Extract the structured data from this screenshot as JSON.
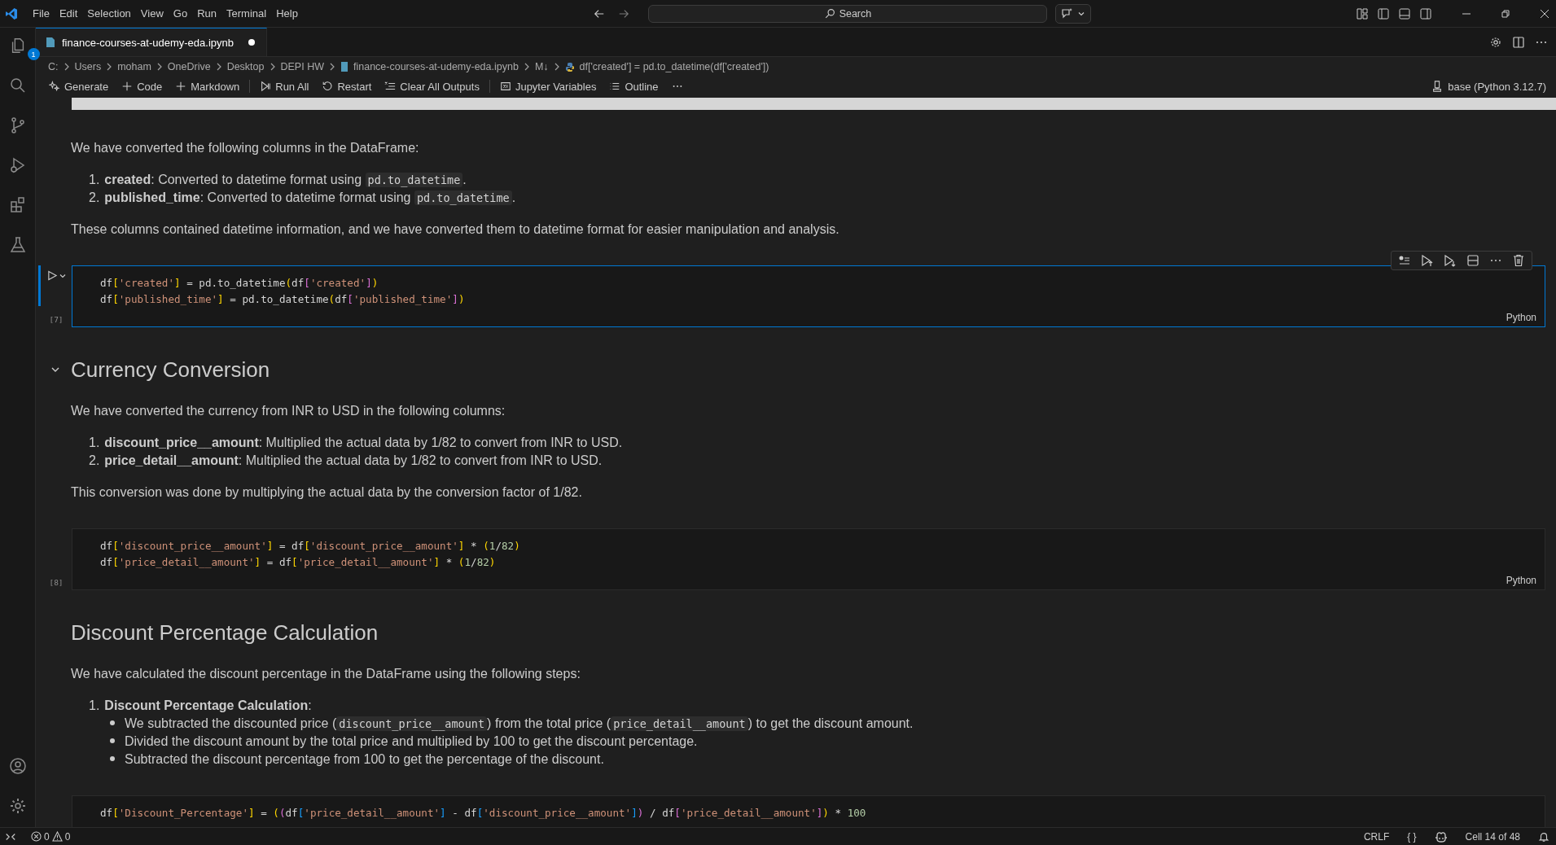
{
  "title_bar": {
    "menus": [
      "File",
      "Edit",
      "Selection",
      "View",
      "Go",
      "Run",
      "Terminal",
      "Help"
    ],
    "search": {
      "placeholder": "Search"
    }
  },
  "activity_bar": {
    "explorer_badge": "1"
  },
  "tabs": [
    {
      "label": "finance-courses-at-udemy-eda.ipynb",
      "selected": true,
      "dirty": true
    }
  ],
  "breadcrumb": [
    {
      "kind": "folder",
      "label": "C:"
    },
    {
      "kind": "folder",
      "label": "Users"
    },
    {
      "kind": "folder",
      "label": "moham"
    },
    {
      "kind": "folder",
      "label": "OneDrive"
    },
    {
      "kind": "folder",
      "label": "Desktop"
    },
    {
      "kind": "folder",
      "label": "DEPI HW"
    },
    {
      "kind": "notebook",
      "label": "finance-courses-at-udemy-eda.ipynb"
    },
    {
      "kind": "folder",
      "label": "M↓"
    },
    {
      "kind": "symbol",
      "label": "df['created'] = pd.to_datetime(df['created'])"
    }
  ],
  "toolbar": {
    "groups": [
      [
        "Generate",
        "Code",
        "Markdown"
      ],
      [
        "Run All",
        "Restart",
        "Clear All Outputs"
      ],
      [
        "Jupyter Variables",
        "Outline"
      ]
    ],
    "kernel": "base (Python 3.12.7)"
  },
  "cells": [
    {
      "kind": "markdown",
      "blocks": [
        {
          "kind": "paragraph",
          "text": "We have converted the following columns in the DataFrame:"
        },
        {
          "kind": "ordered_list",
          "items": [
            {
              "number": "1.",
              "parts": [
                {
                  "kind": "text",
                  "text": "**created**: Converted to datetime format using "
                },
                {
                  "kind": "code",
                  "text": "pd.to_datetime"
                },
                {
                  "kind": "text",
                  "text": "."
                }
              ]
            },
            {
              "number": "2.",
              "parts": [
                {
                  "kind": "text",
                  "text": "**published_time**: Converted to datetime format using "
                },
                {
                  "kind": "code",
                  "text": "pd.to_datetime"
                },
                {
                  "kind": "text",
                  "text": "."
                }
              ]
            }
          ]
        },
        {
          "kind": "paragraph",
          "text": "These columns contained datetime information, and we have converted them to datetime format for easier manipulation and analysis."
        }
      ]
    },
    {
      "kind": "code",
      "execution_count": "[7]",
      "selected": true,
      "language": "Python",
      "lines": [
        [
          {
            "kind": "plain",
            "text": "df"
          },
          {
            "kind": "bracket1",
            "text": "["
          },
          {
            "kind": "string",
            "text": "'created'"
          },
          {
            "kind": "bracket1",
            "text": "]"
          },
          {
            "kind": "plain",
            "text": " = pd.to_datetime"
          },
          {
            "kind": "bracket1",
            "text": "("
          },
          {
            "kind": "plain",
            "text": "df"
          },
          {
            "kind": "bracket2",
            "text": "["
          },
          {
            "kind": "string",
            "text": "'created'"
          },
          {
            "kind": "bracket2",
            "text": "]"
          },
          {
            "kind": "bracket1",
            "text": ")"
          }
        ],
        [
          {
            "kind": "plain",
            "text": "df"
          },
          {
            "kind": "bracket1",
            "text": "["
          },
          {
            "kind": "string",
            "text": "'published_time'"
          },
          {
            "kind": "bracket1",
            "text": "]"
          },
          {
            "kind": "plain",
            "text": " = pd.to_datetime"
          },
          {
            "kind": "bracket1",
            "text": "("
          },
          {
            "kind": "plain",
            "text": "df"
          },
          {
            "kind": "bracket2",
            "text": "["
          },
          {
            "kind": "string",
            "text": "'published_time'"
          },
          {
            "kind": "bracket2",
            "text": "]"
          },
          {
            "kind": "bracket1",
            "text": ")"
          }
        ]
      ]
    },
    {
      "kind": "markdown",
      "blocks": [
        {
          "kind": "heading",
          "text": "Currency Conversion",
          "expanded": true
        },
        {
          "kind": "paragraph",
          "text": "We have converted the currency from INR to USD in the following columns:"
        },
        {
          "kind": "ordered_list",
          "items": [
            {
              "number": "1.",
              "parts": [
                {
                  "kind": "text",
                  "text": "**discount_price__amount**: Multiplied the actual data by 1/82 to convert from INR to USD."
                }
              ]
            },
            {
              "number": "2.",
              "parts": [
                {
                  "kind": "text",
                  "text": "**price_detail__amount**: Multiplied the actual data by 1/82 to convert from INR to USD."
                }
              ]
            }
          ]
        },
        {
          "kind": "paragraph",
          "text": "This conversion was done by multiplying the actual data by the conversion factor of 1/82."
        }
      ]
    },
    {
      "kind": "code",
      "execution_count": "[8]",
      "selected": false,
      "language": "Python",
      "lines": [
        [
          {
            "kind": "plain",
            "text": "df"
          },
          {
            "kind": "bracket1",
            "text": "["
          },
          {
            "kind": "string",
            "text": "'discount_price__amount'"
          },
          {
            "kind": "bracket1",
            "text": "]"
          },
          {
            "kind": "plain",
            "text": " = df"
          },
          {
            "kind": "bracket1",
            "text": "["
          },
          {
            "kind": "string",
            "text": "'discount_price__amount'"
          },
          {
            "kind": "bracket1",
            "text": "]"
          },
          {
            "kind": "plain",
            "text": " * "
          },
          {
            "kind": "bracket1",
            "text": "("
          },
          {
            "kind": "number",
            "text": "1"
          },
          {
            "kind": "plain",
            "text": "/"
          },
          {
            "kind": "number",
            "text": "82"
          },
          {
            "kind": "bracket1",
            "text": ")"
          }
        ],
        [
          {
            "kind": "plain",
            "text": "df"
          },
          {
            "kind": "bracket1",
            "text": "["
          },
          {
            "kind": "string",
            "text": "'price_detail__amount'"
          },
          {
            "kind": "bracket1",
            "text": "]"
          },
          {
            "kind": "plain",
            "text": " = df"
          },
          {
            "kind": "bracket1",
            "text": "["
          },
          {
            "kind": "string",
            "text": "'price_detail__amount'"
          },
          {
            "kind": "bracket1",
            "text": "]"
          },
          {
            "kind": "plain",
            "text": " * "
          },
          {
            "kind": "bracket1",
            "text": "("
          },
          {
            "kind": "number",
            "text": "1"
          },
          {
            "kind": "plain",
            "text": "/"
          },
          {
            "kind": "number",
            "text": "82"
          },
          {
            "kind": "bracket1",
            "text": ")"
          }
        ]
      ]
    },
    {
      "kind": "markdown",
      "blocks": [
        {
          "kind": "heading",
          "text": "Discount Percentage Calculation"
        },
        {
          "kind": "paragraph",
          "text": "We have calculated the discount percentage in the DataFrame using the following steps:"
        },
        {
          "kind": "ordered_list",
          "items": [
            {
              "number": "1.",
              "parts": [
                {
                  "kind": "text",
                  "text": "**Discount Percentage Calculation**:"
                }
              ],
              "children": [
                {
                  "parts": [
                    {
                      "kind": "text",
                      "text": "We subtracted the discounted price ("
                    },
                    {
                      "kind": "code",
                      "text": "discount_price__amount"
                    },
                    {
                      "kind": "text",
                      "text": ") from the total price ("
                    },
                    {
                      "kind": "code",
                      "text": "price_detail__amount"
                    },
                    {
                      "kind": "text",
                      "text": ") to get the discount amount."
                    }
                  ]
                },
                {
                  "parts": [
                    {
                      "kind": "text",
                      "text": "Divided the discount amount by the total price and multiplied by 100 to get the discount percentage."
                    }
                  ]
                },
                {
                  "parts": [
                    {
                      "kind": "text",
                      "text": "Subtracted the discount percentage from 100 to get the percentage of the discount."
                    }
                  ]
                }
              ]
            }
          ]
        }
      ]
    },
    {
      "kind": "code",
      "selected": false,
      "lines": [
        [
          {
            "kind": "plain",
            "text": "df"
          },
          {
            "kind": "bracket1",
            "text": "["
          },
          {
            "kind": "string",
            "text": "'Discount_Percentage'"
          },
          {
            "kind": "bracket1",
            "text": "]"
          },
          {
            "kind": "plain",
            "text": " = "
          },
          {
            "kind": "bracket1",
            "text": "("
          },
          {
            "kind": "bracket2",
            "text": "("
          },
          {
            "kind": "plain",
            "text": "df"
          },
          {
            "kind": "bracket3",
            "text": "["
          },
          {
            "kind": "string",
            "text": "'price_detail__amount'"
          },
          {
            "kind": "bracket3",
            "text": "]"
          },
          {
            "kind": "plain",
            "text": " - df"
          },
          {
            "kind": "bracket3",
            "text": "["
          },
          {
            "kind": "string",
            "text": "'discount_price__amount'"
          },
          {
            "kind": "bracket3",
            "text": "]"
          },
          {
            "kind": "bracket2",
            "text": ")"
          },
          {
            "kind": "plain",
            "text": " / df"
          },
          {
            "kind": "bracket2",
            "text": "["
          },
          {
            "kind": "string",
            "text": "'price_detail__amount'"
          },
          {
            "kind": "bracket2",
            "text": "]"
          },
          {
            "kind": "bracket1",
            "text": ")"
          },
          {
            "kind": "plain",
            "text": " * "
          },
          {
            "kind": "number",
            "text": "100"
          }
        ]
      ]
    }
  ],
  "status_bar": {
    "errors": "0",
    "warnings": "0",
    "eol": "CRLF",
    "braces": "{ }",
    "cell_position": "Cell 14 of 48"
  }
}
